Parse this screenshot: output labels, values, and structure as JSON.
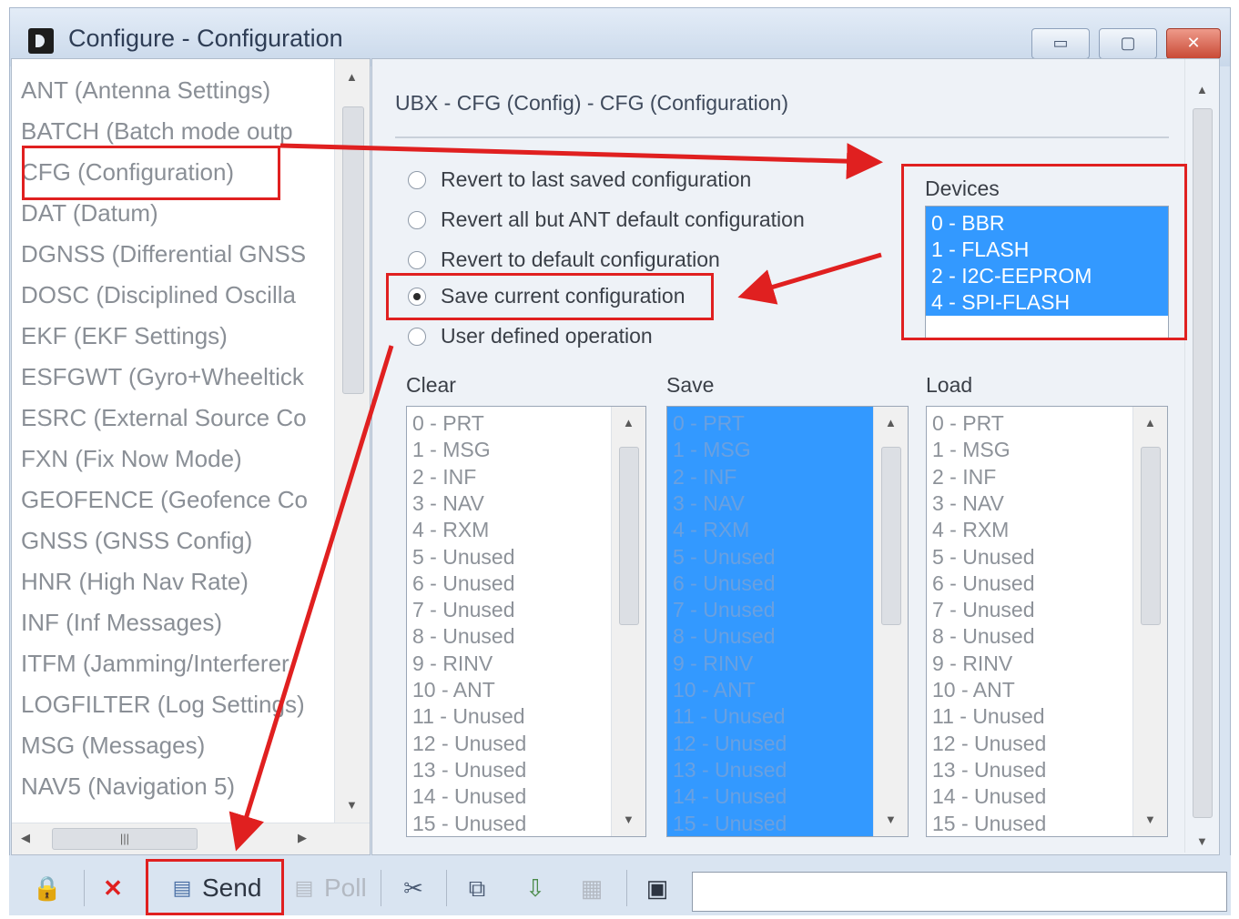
{
  "window": {
    "title": "Configure - Configuration",
    "controls": {
      "minimize": "▭",
      "maximize": "▢",
      "close": "✕"
    }
  },
  "message_list": {
    "items": [
      "ANT (Antenna Settings)",
      "BATCH (Batch mode outp",
      "CFG (Configuration)",
      "DAT (Datum)",
      "DGNSS (Differential GNSS",
      "DOSC (Disciplined Oscilla",
      "EKF (EKF Settings)",
      "ESFGWT (Gyro+Wheeltick",
      "ESRC (External Source Co",
      "FXN (Fix Now Mode)",
      "GEOFENCE (Geofence Co",
      "GNSS (GNSS Config)",
      "HNR (High Nav Rate)",
      "INF (Inf Messages)",
      "ITFM (Jamming/Interferer",
      "LOGFILTER (Log Settings)",
      "MSG (Messages)",
      "NAV5 (Navigation 5)"
    ],
    "hscroll_grip": "|||"
  },
  "config": {
    "title": "UBX - CFG (Config) - CFG (Configuration)",
    "options": [
      {
        "label": "Revert to last saved configuration",
        "selected": false
      },
      {
        "label": "Revert all but ANT default configuration",
        "selected": false
      },
      {
        "label": "Revert to default configuration",
        "selected": false
      },
      {
        "label": "Save current configuration",
        "selected": true
      },
      {
        "label": "User defined operation",
        "selected": false
      }
    ],
    "devices_label": "Devices",
    "devices": [
      "0 - BBR",
      "1 - FLASH",
      "2 - I2C-EEPROM",
      "4 - SPI-FLASH"
    ],
    "clear_label": "Clear",
    "save_label": "Save",
    "load_label": "Load",
    "sections": [
      "0 - PRT",
      "1 - MSG",
      "2 - INF",
      "3 - NAV",
      "4 - RXM",
      "5 - Unused",
      "6 - Unused",
      "7 - Unused",
      "8 - Unused",
      "9 - RINV",
      "10 - ANT",
      "11 - Unused",
      "12 - Unused",
      "13 - Unused",
      "14 - Unused",
      "15 - Unused"
    ]
  },
  "toolbar": {
    "send_label": "Send",
    "poll_label": "Poll",
    "lock_icon": "lock-icon",
    "cancel_icon": "x-icon"
  },
  "colors": {
    "highlight_red": "#e02020",
    "selection_blue": "#3399ff"
  }
}
